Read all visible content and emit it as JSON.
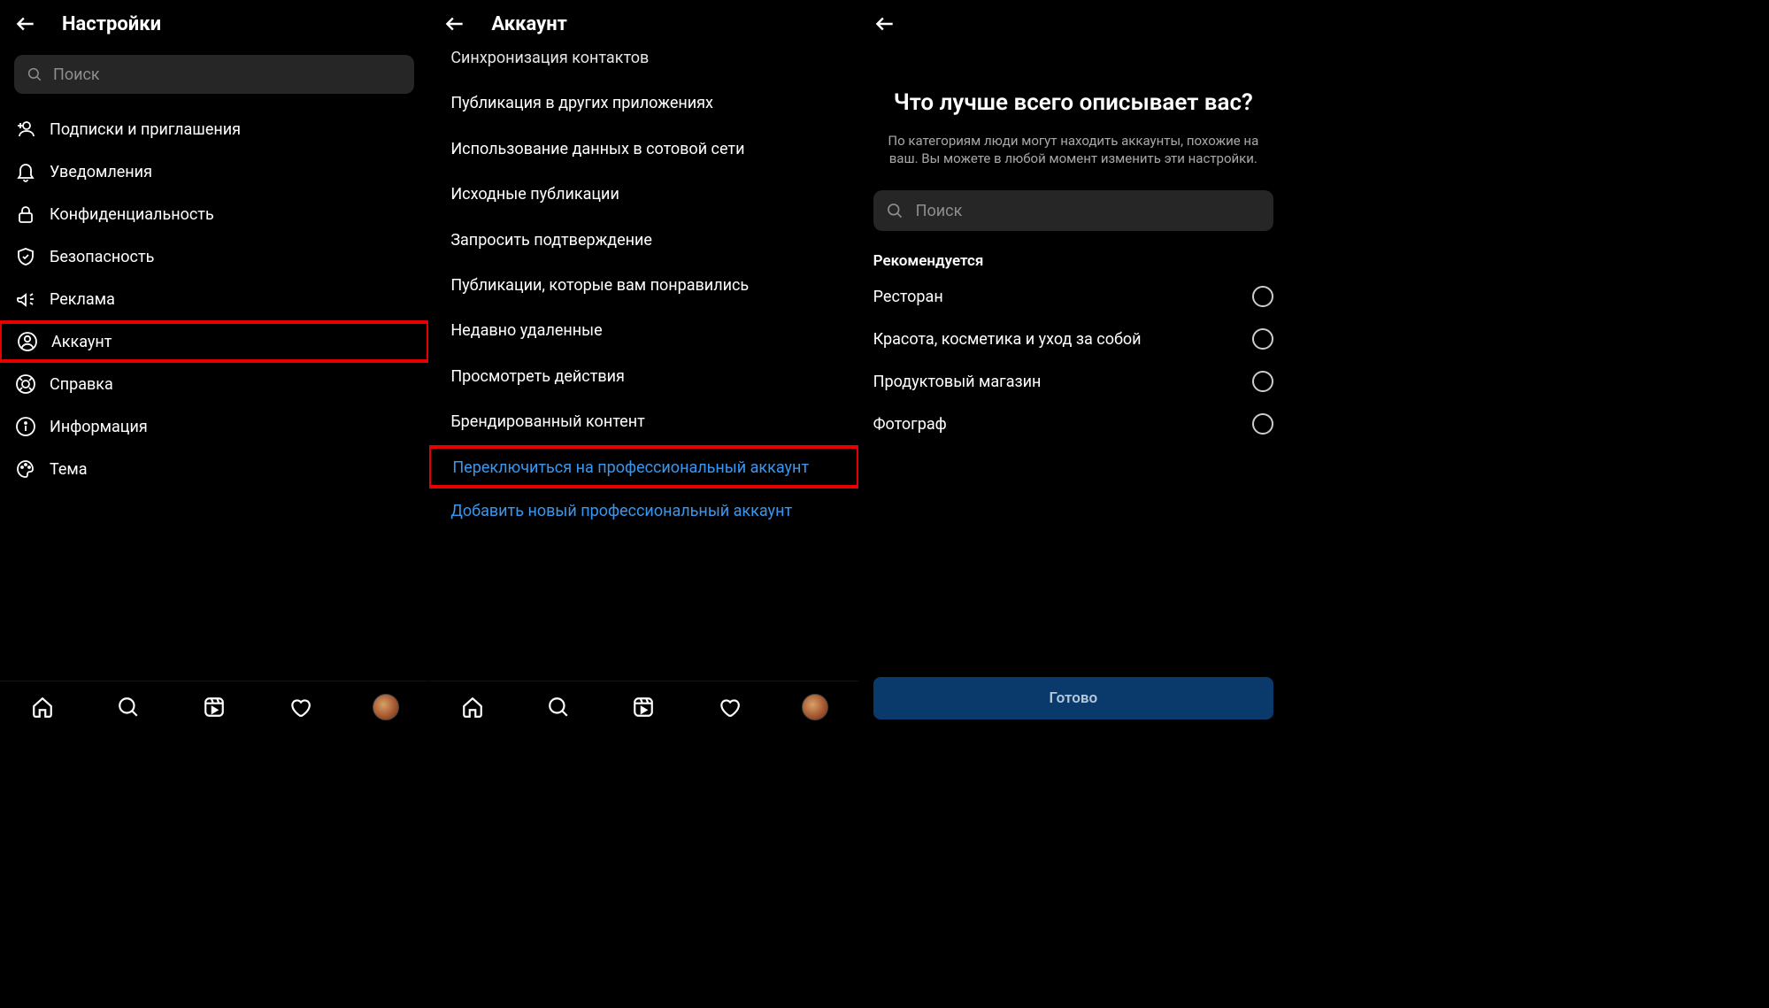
{
  "screen1": {
    "title": "Настройки",
    "search_placeholder": "Поиск",
    "items": [
      {
        "label": "Подписки и приглашения"
      },
      {
        "label": "Уведомления"
      },
      {
        "label": "Конфиденциальность"
      },
      {
        "label": "Безопасность"
      },
      {
        "label": "Реклама"
      },
      {
        "label": "Аккаунт"
      },
      {
        "label": "Справка"
      },
      {
        "label": "Информация"
      },
      {
        "label": "Тема"
      }
    ]
  },
  "screen2": {
    "title": "Аккаунт",
    "rows": [
      {
        "label": "Синхронизация контактов",
        "cut": true
      },
      {
        "label": "Публикация в других приложениях"
      },
      {
        "label": "Использование данных в сотовой сети"
      },
      {
        "label": "Исходные публикации"
      },
      {
        "label": "Запросить подтверждение"
      },
      {
        "label": "Публикации, которые вам понравились"
      },
      {
        "label": "Недавно удаленные"
      },
      {
        "label": "Просмотреть действия"
      },
      {
        "label": "Брендированный контент"
      },
      {
        "label": "Переключиться на профессиональный аккаунт",
        "link": true,
        "highlight": true
      },
      {
        "label": "Добавить новый профессиональный аккаунт",
        "link": true
      }
    ]
  },
  "screen3": {
    "title": "Что лучше всего описывает вас?",
    "desc": "По категориям люди могут находить аккаунты, похожие на ваш. Вы можете в любой момент изменить эти настройки.",
    "search_placeholder": "Поиск",
    "section_label": "Рекомендуется",
    "options": [
      {
        "label": "Ресторан"
      },
      {
        "label": "Красота, косметика и уход за собой"
      },
      {
        "label": "Продуктовый магазин"
      },
      {
        "label": "Фотограф"
      }
    ],
    "done_label": "Готово"
  }
}
